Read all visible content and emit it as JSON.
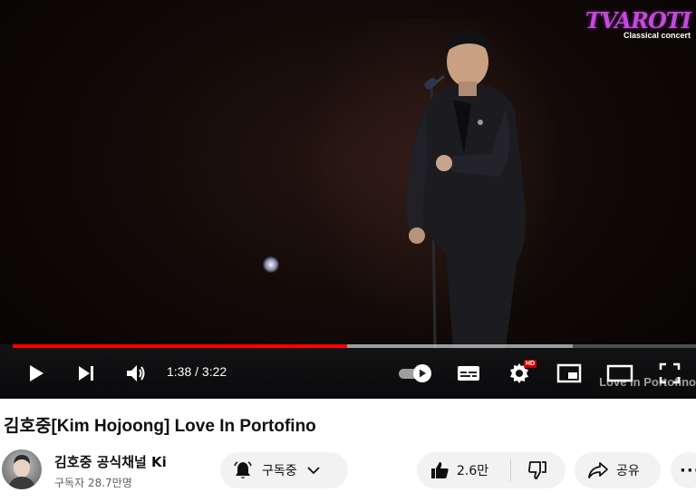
{
  "video": {
    "watermark_brand": "TVAROTI",
    "watermark_sub": "Classical concert",
    "overlay_caption": "Love in Portofino",
    "progress_played_fraction": 0.4898,
    "time_current": "1:38",
    "time_separator": " / ",
    "time_total": "3:22",
    "settings_badge": "HD",
    "icons": [
      "play-icon",
      "next-icon",
      "volume-icon",
      "autoplay-toggle",
      "subtitles-icon",
      "settings-icon",
      "miniplayer-icon",
      "theater-icon",
      "fullscreen-icon"
    ],
    "accent_color": "#ff0000"
  },
  "info": {
    "title": "김호중[Kim Hojoong] Love In Portofino",
    "channel_name": "김호중 공식채널 Ki",
    "subscribers": "구독자 28.7만명",
    "subscribe_label": "구독중",
    "like_count": "2.6만",
    "share_label": "공유",
    "more_label": "···"
  }
}
